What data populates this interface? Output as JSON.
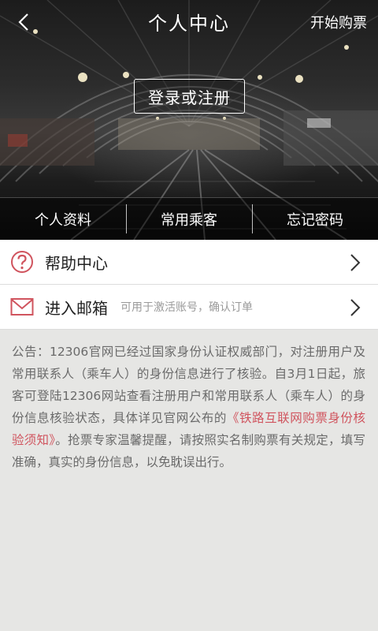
{
  "header": {
    "title": "个人中心",
    "back_icon": "chevron-left-icon",
    "buy_label": "开始购票"
  },
  "hero": {
    "login_label": "登录或注册"
  },
  "tabs": [
    {
      "label": "个人资料"
    },
    {
      "label": "常用乘客"
    },
    {
      "label": "忘记密码"
    }
  ],
  "menu": [
    {
      "label": "帮助中心",
      "hint": "",
      "icon": "help-icon"
    },
    {
      "label": "进入邮箱",
      "hint": "可用于激活账号，确认订单",
      "icon": "mail-icon"
    }
  ],
  "notice": {
    "text_before": "公告：12306官网已经过国家身份认证权威部门，对注册用户及常用联系人（乘车人）的身份信息进行了核验。自3月1日起，旅客可登陆12306网站查看注册用户和常用联系人（乘车人）的身份信息核验状态，具体详见官网公布的",
    "link_text": "《铁路互联网购票身份核验须知》",
    "text_after": "。抢票专家温馨提醒，请按照实名制购票有关规定，填写准确，真实的身份信息，以免耽误出行。"
  },
  "colors": {
    "accent": "#d0545e",
    "notice_bg": "#e6e6e4",
    "notice_text": "#6a6a6a"
  }
}
